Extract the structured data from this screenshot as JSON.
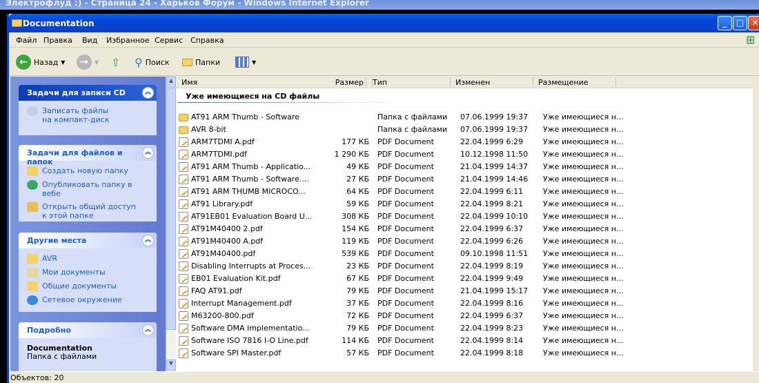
{
  "browser_title": "Электрофлуд :) - Страница 24 - Харьков Форум - Windows Internet Explorer",
  "window": {
    "title": "Documentation"
  },
  "menu": [
    "Файл",
    "Правка",
    "Вид",
    "Избранное",
    "Сервис",
    "Справка"
  ],
  "toolbar": {
    "back": "Назад",
    "search": "Поиск",
    "folders": "Папки"
  },
  "left": {
    "cd_tasks": {
      "title": "Задачи для записи CD",
      "items": [
        "Записать файлы на компакт-диск"
      ]
    },
    "file_tasks": {
      "title": "Задачи для файлов и папок",
      "items": [
        "Создать новую папку",
        "Опубликовать папку в вебе",
        "Открыть общий доступ к этой папке"
      ]
    },
    "other_places": {
      "title": "Другие места",
      "items": [
        "AVR",
        "Мои документы",
        "Общие документы",
        "Сетевое окружение"
      ]
    },
    "details": {
      "title": "Подробно",
      "name": "Documentation",
      "type": "Папка с файлами"
    }
  },
  "columns": [
    "Имя",
    "Размер",
    "Тип",
    "Изменен",
    "Размещение"
  ],
  "group": "Уже имеющиеся на CD файлы",
  "files": [
    {
      "icon": "folder",
      "name": "AT91 ARM Thumb - Software",
      "size": "",
      "type": "Папка с файлами",
      "modified": "07.06.1999 19:37",
      "location": "Уже имеющиеся н..."
    },
    {
      "icon": "folder",
      "name": "AVR 8-bit",
      "size": "",
      "type": "Папка с файлами",
      "modified": "07.06.1999 19:37",
      "location": "Уже имеющиеся н..."
    },
    {
      "icon": "pdf",
      "name": "ARM7TDMI A.pdf",
      "size": "177 КБ",
      "type": "PDF Document",
      "modified": "22.04.1999 6:29",
      "location": "Уже имеющиеся н..."
    },
    {
      "icon": "pdf",
      "name": "ARM7TDMI.pdf",
      "size": "1 290 КБ",
      "type": "PDF Document",
      "modified": "10.12.1998 11:50",
      "location": "Уже имеющиеся н..."
    },
    {
      "icon": "pdf",
      "name": "AT91 ARM Thumb - Applicatio...",
      "size": "49 КБ",
      "type": "PDF Document",
      "modified": "21.04.1999 14:37",
      "location": "Уже имеющиеся н..."
    },
    {
      "icon": "pdf",
      "name": "AT91 ARM Thumb - Software....",
      "size": "27 КБ",
      "type": "PDF Document",
      "modified": "21.04.1999 14:46",
      "location": "Уже имеющиеся н..."
    },
    {
      "icon": "pdf",
      "name": "AT91 ARM THUMB MICROCO...",
      "size": "64 КБ",
      "type": "PDF Document",
      "modified": "22.04.1999 6:11",
      "location": "Уже имеющиеся н..."
    },
    {
      "icon": "pdf",
      "name": "AT91 Library.pdf",
      "size": "59 КБ",
      "type": "PDF Document",
      "modified": "22.04.1999 8:21",
      "location": "Уже имеющиеся н..."
    },
    {
      "icon": "pdf",
      "name": "AT91EB01 Evaluation Board U...",
      "size": "308 КБ",
      "type": "PDF Document",
      "modified": "22.04.1999 10:10",
      "location": "Уже имеющиеся н..."
    },
    {
      "icon": "pdf",
      "name": "AT91M40400 2.pdf",
      "size": "154 КБ",
      "type": "PDF Document",
      "modified": "22.04.1999 6:37",
      "location": "Уже имеющиеся н..."
    },
    {
      "icon": "pdf",
      "name": "AT91M40400 A.pdf",
      "size": "119 КБ",
      "type": "PDF Document",
      "modified": "22.04.1999 6:26",
      "location": "Уже имеющиеся н..."
    },
    {
      "icon": "pdf",
      "name": "AT91M40400.pdf",
      "size": "539 КБ",
      "type": "PDF Document",
      "modified": "09.10.1998 11:51",
      "location": "Уже имеющиеся н..."
    },
    {
      "icon": "pdf",
      "name": "Disabling Interrupts at Proces...",
      "size": "23 КБ",
      "type": "PDF Document",
      "modified": "22.04.1999 8:19",
      "location": "Уже имеющиеся н..."
    },
    {
      "icon": "pdf",
      "name": "EB01 Evaluation Kit.pdf",
      "size": "67 КБ",
      "type": "PDF Document",
      "modified": "22.04.1999 9:49",
      "location": "Уже имеющиеся н..."
    },
    {
      "icon": "pdf",
      "name": "FAQ AT91.pdf",
      "size": "79 КБ",
      "type": "PDF Document",
      "modified": "21.04.1999 15:17",
      "location": "Уже имеющиеся н..."
    },
    {
      "icon": "pdf",
      "name": "Interrupt Management.pdf",
      "size": "37 КБ",
      "type": "PDF Document",
      "modified": "22.04.1999 8:16",
      "location": "Уже имеющиеся н..."
    },
    {
      "icon": "pdf",
      "name": "M63200-800.pdf",
      "size": "72 КБ",
      "type": "PDF Document",
      "modified": "22.04.1999 6:37",
      "location": "Уже имеющиеся н..."
    },
    {
      "icon": "pdf",
      "name": "Software DMA Implementatio...",
      "size": "79 КБ",
      "type": "PDF Document",
      "modified": "22.04.1999 8:23",
      "location": "Уже имеющиеся н..."
    },
    {
      "icon": "pdf",
      "name": "Software ISO 7816 I-O Line.pdf",
      "size": "114 КБ",
      "type": "PDF Document",
      "modified": "22.04.1999 8:14",
      "location": "Уже имеющиеся н..."
    },
    {
      "icon": "pdf",
      "name": "Software SPI Master.pdf",
      "size": "57 КБ",
      "type": "PDF Document",
      "modified": "22.04.1999 8:18",
      "location": "Уже имеющиеся н..."
    }
  ],
  "status": "Объектов: 20"
}
